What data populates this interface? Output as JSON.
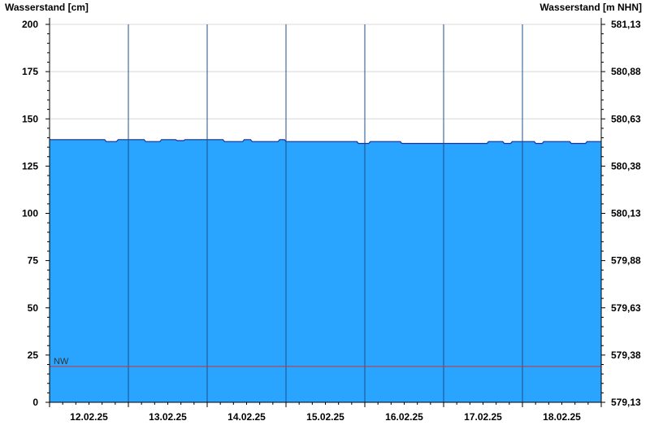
{
  "chart_data": {
    "type": "area",
    "title": "",
    "ylabel_left": "Wasserstand [cm]",
    "ylabel_right": "Wasserstand [m NHN]",
    "ylim": [
      0,
      200
    ],
    "y_ticks_left": [
      "0",
      "25",
      "50",
      "75",
      "100",
      "125",
      "150",
      "175",
      "200"
    ],
    "y_ticks_right": [
      "579,13",
      "579,38",
      "579,63",
      "579,88",
      "580,13",
      "580,38",
      "580,63",
      "580,88",
      "581,13"
    ],
    "x_labels": [
      "12.02.25",
      "13.02.25",
      "14.02.25",
      "15.02.25",
      "16.02.25",
      "17.02.25",
      "18.02.25"
    ],
    "x_range_days": [
      0,
      7
    ],
    "grid": true,
    "colors": {
      "fill": "#29a4ff",
      "line": "#1a2f8f",
      "nw_line": "#cc3333",
      "grid": "#d8d8d8"
    },
    "series": [
      {
        "x": [
          0.0,
          0.7,
          0.72,
          0.85,
          0.87,
          1.2,
          1.22,
          1.4,
          1.42,
          1.6,
          1.62,
          1.7,
          1.72,
          1.8,
          1.82,
          2.2,
          2.22,
          2.45,
          2.47,
          2.55,
          2.57,
          2.9,
          2.92,
          2.98,
          3.0,
          3.3,
          3.32,
          3.9,
          3.92,
          4.05,
          4.07,
          4.45,
          4.47,
          5.0,
          5.2,
          5.4,
          5.55,
          5.57,
          5.75,
          5.77,
          5.85,
          5.87,
          6.15,
          6.17,
          6.25,
          6.27,
          6.6,
          6.62,
          6.8,
          6.82,
          7.0
        ],
        "y": [
          139,
          139,
          138,
          138,
          139,
          139,
          138,
          138,
          139,
          139,
          138.5,
          138.5,
          139,
          139,
          139,
          139,
          138,
          138,
          139,
          139,
          138,
          138,
          139,
          139,
          138,
          138,
          138,
          138,
          137,
          137,
          138,
          138,
          137,
          137,
          137,
          137,
          137,
          138,
          138,
          137,
          137,
          138,
          138,
          137,
          137,
          138,
          138,
          137,
          137,
          138,
          138
        ]
      }
    ],
    "reference_lines": [
      {
        "label": "NW",
        "y": 19
      }
    ]
  }
}
